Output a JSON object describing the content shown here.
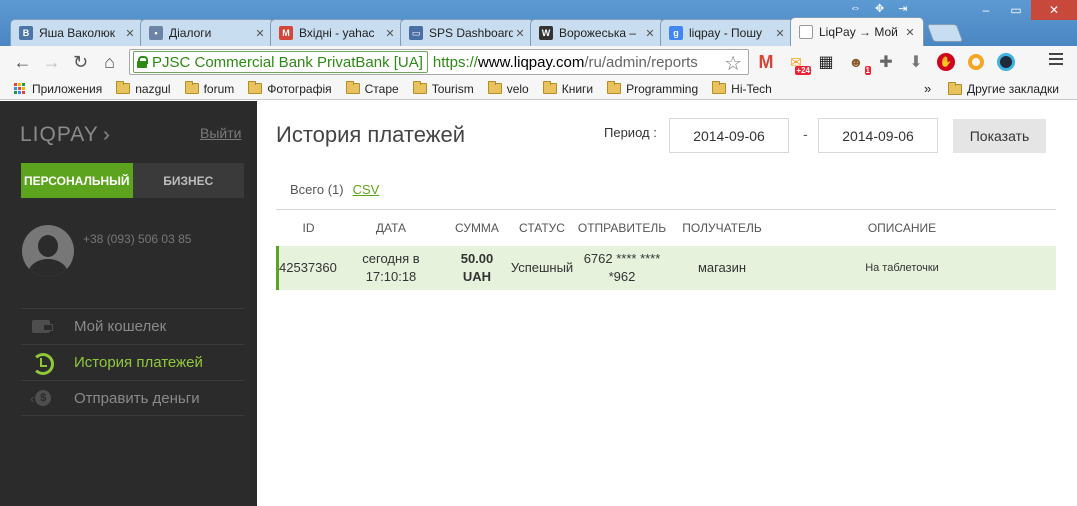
{
  "browser": {
    "tabs": [
      {
        "title": "Яша Ваколюк",
        "favicon": "vk-icon",
        "color": "#4a76a8",
        "glyph": "B"
      },
      {
        "title": "Діалоги",
        "favicon": "chat-icon",
        "color": "#6d84a6",
        "glyph": "▪"
      },
      {
        "title": "Вхідні - yahac",
        "favicon": "gmail-icon",
        "color": "#d44638",
        "glyph": "M"
      },
      {
        "title": "SPS Dashboard",
        "favicon": "laptop-icon",
        "color": "#4a6fa5",
        "glyph": "▭"
      },
      {
        "title": "Ворожеська –",
        "favicon": "wikipedia-icon",
        "color": "#333333",
        "glyph": "W"
      },
      {
        "title": "liqpay - Пошу",
        "favicon": "google-icon",
        "color": "#4285f4",
        "glyph": "g"
      },
      {
        "title": "LiqPay → Мой",
        "favicon": "page-icon",
        "color": "#ffffff",
        "glyph": ""
      }
    ],
    "active_tab": 6,
    "security_chip": "PJSC Commercial Bank PrivatBank [UA]",
    "url_scheme": "https://",
    "url_host": "www.liqpay.com",
    "url_path": "/ru/admin/reports",
    "extension_badges": {
      "mail": "+24",
      "profile": "1"
    },
    "bookmarks": [
      {
        "label": "Приложения",
        "type": "apps"
      },
      {
        "label": "nazgul",
        "type": "folder"
      },
      {
        "label": "forum",
        "type": "folder"
      },
      {
        "label": "Фотографія",
        "type": "folder"
      },
      {
        "label": "Старе",
        "type": "folder"
      },
      {
        "label": "Tourism",
        "type": "folder"
      },
      {
        "label": "velo",
        "type": "folder"
      },
      {
        "label": "Книги",
        "type": "folder"
      },
      {
        "label": "Programming",
        "type": "folder"
      },
      {
        "label": "Hi-Tech",
        "type": "folder"
      }
    ],
    "bookmarks_overflow": "»",
    "other_bookmarks": "Другие закладки"
  },
  "sidebar": {
    "logo": "LIQPAY",
    "logout": "Выйти",
    "modes": {
      "personal": "ПЕРСОНАЛЬНЫЙ",
      "business": "БИЗНЕС"
    },
    "phone": "+38 (093) 506 03 85",
    "menu": [
      {
        "label": "Мой кошелек",
        "icon": "wallet-icon",
        "active": false
      },
      {
        "label": "История платежей",
        "icon": "history-icon",
        "active": true
      },
      {
        "label": "Отправить деньги",
        "icon": "send-money-icon",
        "active": false
      }
    ],
    "accent_color": "#5da41e"
  },
  "main": {
    "title": "История платежей",
    "period_label": "Период :",
    "date_from": "2014-09-06",
    "date_separator": "-",
    "date_to": "2014-09-06",
    "show_button": "Показать",
    "total_label": "Всего (1)",
    "csv_link": "CSV",
    "columns": [
      "ID",
      "ДАТА",
      "СУММА",
      "СТАТУС",
      "ОТПРАВИТЕЛЬ",
      "ПОЛУЧАТЕЛЬ",
      "ОПИСАНИЕ"
    ],
    "rows": [
      {
        "id": "42537360",
        "date_line1": "сегодня в",
        "date_line2": "17:10:18",
        "amount": "50.00",
        "currency": "UAH",
        "status": "Успешный",
        "sender_line1": "6762 **** ****",
        "sender_line2": "*962",
        "recipient": "магазин",
        "description": "На таблеточки"
      }
    ]
  }
}
